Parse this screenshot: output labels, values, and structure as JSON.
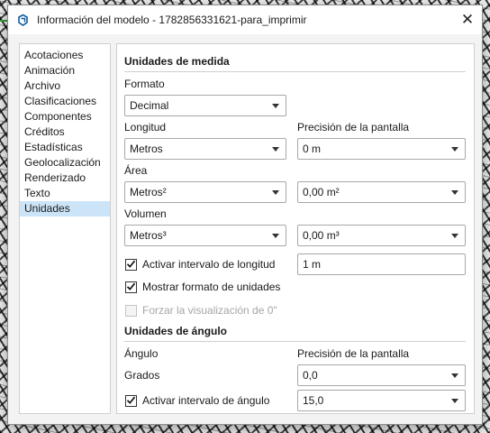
{
  "window": {
    "title": "Información del modelo - 1782856331621-para_imprimir",
    "close_label": "✕",
    "app_icon": "sketchup-logo-icon"
  },
  "sidebar": {
    "items": [
      {
        "label": "Acotaciones",
        "selected": false
      },
      {
        "label": "Animación",
        "selected": false
      },
      {
        "label": "Archivo",
        "selected": false
      },
      {
        "label": "Clasificaciones",
        "selected": false
      },
      {
        "label": "Componentes",
        "selected": false
      },
      {
        "label": "Créditos",
        "selected": false
      },
      {
        "label": "Estadísticas",
        "selected": false
      },
      {
        "label": "Geolocalización",
        "selected": false
      },
      {
        "label": "Renderizado",
        "selected": false
      },
      {
        "label": "Texto",
        "selected": false
      },
      {
        "label": "Unidades",
        "selected": true
      }
    ]
  },
  "units": {
    "title": "Unidades de medida",
    "format": {
      "label": "Formato",
      "value": "Decimal"
    },
    "length": {
      "label": "Longitud",
      "value": "Metros"
    },
    "precision": {
      "label": "Precisión de la pantalla",
      "value": "0 m"
    },
    "area": {
      "label": "Área",
      "value": "Metros²",
      "precision_value": "0,00 m²"
    },
    "volume": {
      "label": "Volumen",
      "value": "Metros³",
      "precision_value": "0,00 m³"
    },
    "length_snap": {
      "label": "Activar intervalo de longitud",
      "checked": true,
      "value": "1 m"
    },
    "show_format": {
      "label": "Mostrar formato de unidades",
      "checked": true
    },
    "force_zero": {
      "label": "Forzar la visualización de 0\"",
      "checked": false,
      "disabled": true
    }
  },
  "angle": {
    "title": "Unidades de ángulo",
    "label": "Ángulo",
    "precision_label": "Precisión de la pantalla",
    "unit": "Grados",
    "precision_value": "0,0",
    "snap": {
      "label": "Activar intervalo de ángulo",
      "checked": true,
      "value": "15,0"
    }
  },
  "colors": {
    "selection": "#cce4f7",
    "app_icon": "#0f5d9e",
    "accent_green": "#2f9e3b"
  }
}
